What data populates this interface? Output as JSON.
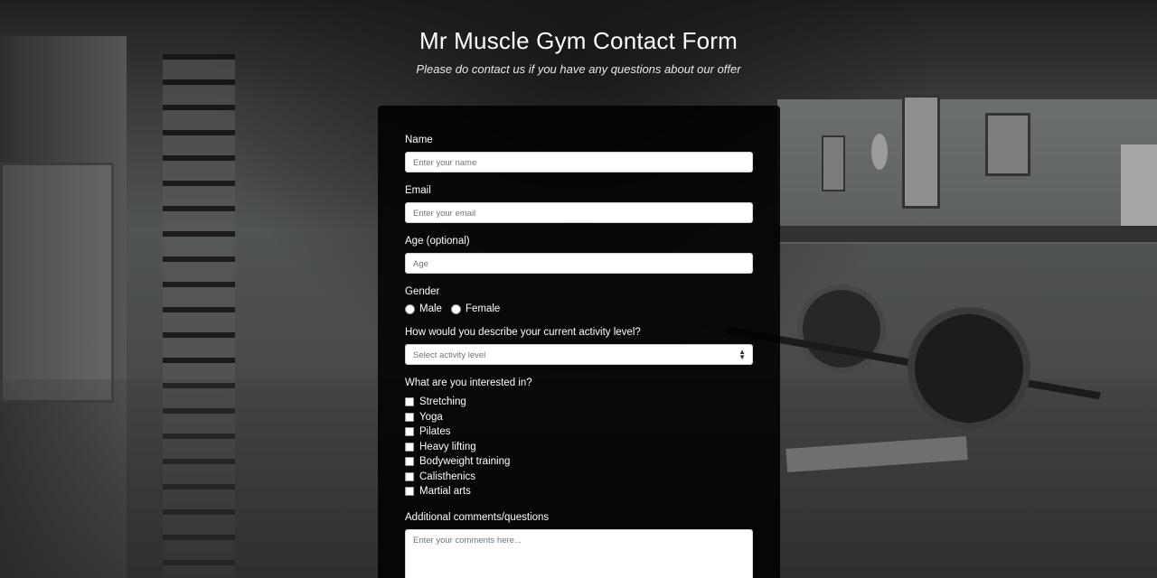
{
  "header": {
    "title": "Mr Muscle Gym Contact Form",
    "subtitle": "Please do contact us if you have any questions about our offer"
  },
  "form": {
    "name": {
      "label": "Name",
      "placeholder": "Enter your name"
    },
    "email": {
      "label": "Email",
      "placeholder": "Enter your email"
    },
    "age": {
      "label": "Age (optional)",
      "placeholder": "Age"
    },
    "gender": {
      "label": "Gender",
      "options": [
        "Male",
        "Female"
      ]
    },
    "activity": {
      "label": "How would you describe your current activity level?",
      "selected": "Select activity level"
    },
    "interests": {
      "label": "What are you interested in?",
      "options": [
        "Stretching",
        "Yoga",
        "Pilates",
        "Heavy lifting",
        "Bodyweight training",
        "Calisthenics",
        "Martial arts"
      ]
    },
    "comments": {
      "label": "Additional comments/questions",
      "placeholder": "Enter your comments here..."
    }
  }
}
